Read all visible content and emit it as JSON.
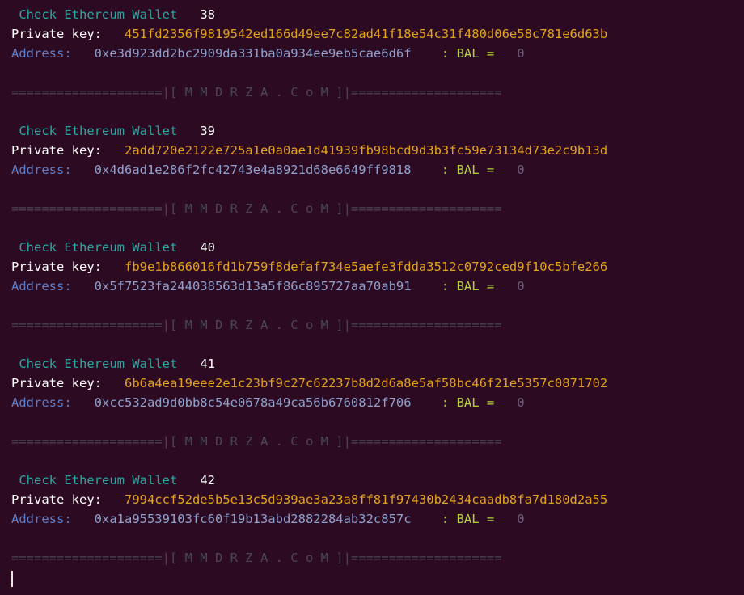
{
  "terminal": {
    "header_label": "Check Ethereum Wallet",
    "private_key_label": "Private key:",
    "address_label": "Address:",
    "bal_label": ": BAL =",
    "separator": "====================|[ M M D R Z A . C o M ]|===================="
  },
  "entries": [
    {
      "number": "38",
      "private_key": "451fd2356f9819542ed166d49ee7c82ad41f18e54c31f480d06e58c781e6d63b",
      "address": "0xe3d923dd2bc2909da331ba0a934ee9eb5cae6d6f",
      "balance": "0"
    },
    {
      "number": "39",
      "private_key": "2add720e2122e725a1e0a0ae1d41939fb98bcd9d3b3fc59e73134d73e2c9b13d",
      "address": "0x4d6ad1e286f2fc42743e4a8921d68e6649ff9818",
      "balance": "0"
    },
    {
      "number": "40",
      "private_key": "fb9e1b866016fd1b759f8defaf734e5aefe3fdda3512c0792ced9f10c5bfe266",
      "address": "0x5f7523fa244038563d13a5f86c895727aa70ab91",
      "balance": "0"
    },
    {
      "number": "41",
      "private_key": "6b6a4ea19eee2e1c23bf9c27c62237b8d2d6a8e5af58bc46f21e5357c0871702",
      "address": "0xcc532ad9d0bb8c54e0678a49ca56b6760812f706",
      "balance": "0"
    },
    {
      "number": "42",
      "private_key": "7994ccf52de5b5e13c5d939ae3a23a8ff81f97430b2434caadb8fa7d180d2a55",
      "address": "0xa1a95539103fc60f19b13abd2882284ab32c857c",
      "balance": "0"
    }
  ]
}
